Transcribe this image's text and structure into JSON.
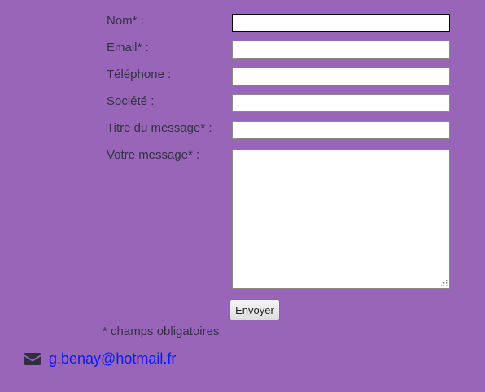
{
  "form": {
    "fields": [
      {
        "label": "Nom* :",
        "value": ""
      },
      {
        "label": "Email* :",
        "value": ""
      },
      {
        "label": "Téléphone :",
        "value": ""
      },
      {
        "label": "Société :",
        "value": ""
      },
      {
        "label": "Titre du message* :",
        "value": ""
      }
    ],
    "message_label": "Votre message* :",
    "message_value": "",
    "submit_label": "Envoyer",
    "required_note": "* champs obligatoires"
  },
  "contact": {
    "icon": "envelope-icon",
    "email": "g.benay@hotmail.fr"
  },
  "colors": {
    "background": "#9865b9",
    "text": "#333344",
    "link": "#0a1cf0"
  }
}
